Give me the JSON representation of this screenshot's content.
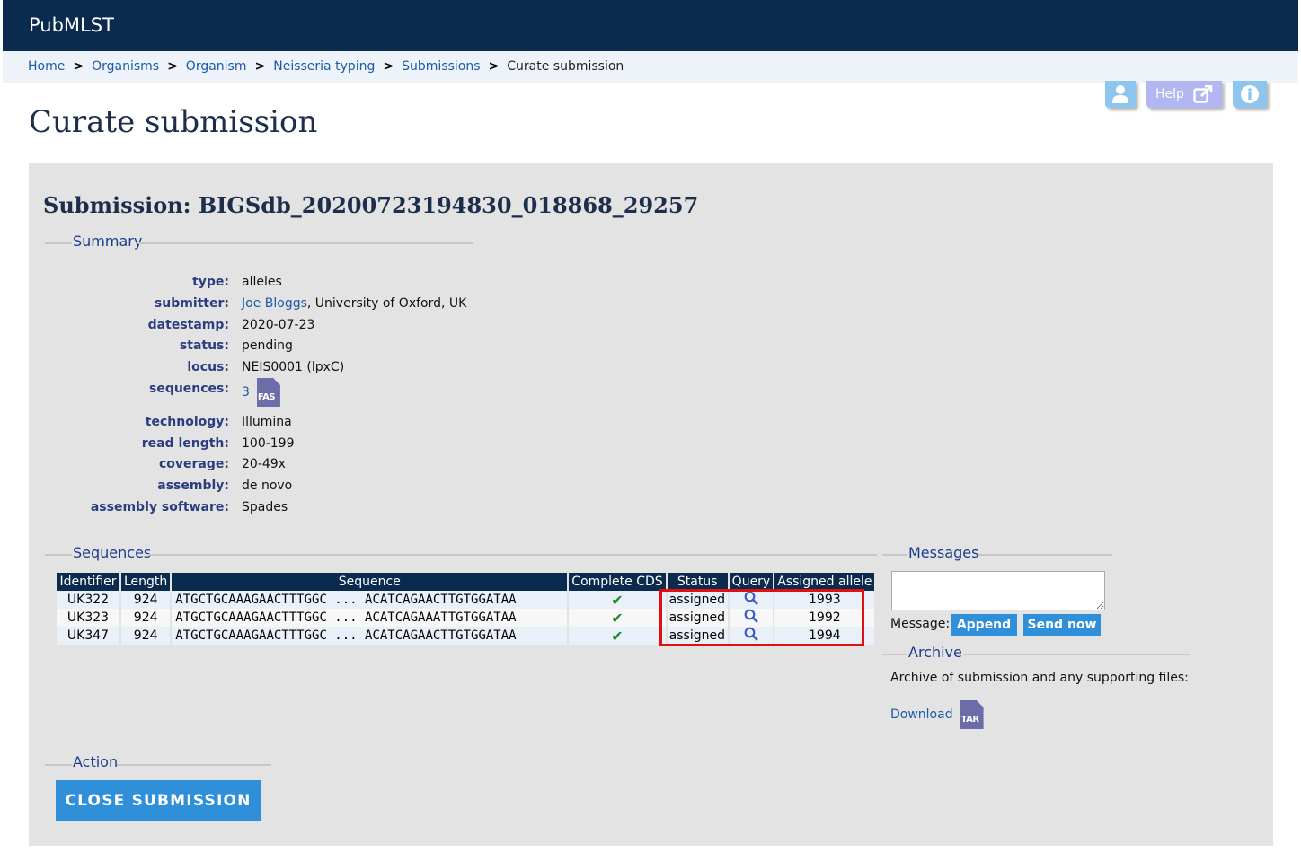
{
  "app": {
    "brand": "PubMLST"
  },
  "breadcrumb": {
    "links": [
      "Home",
      "Organisms",
      "Organism",
      "Neisseria typing",
      "Submissions"
    ],
    "separator": ">",
    "current": "Curate submission"
  },
  "toolbar": {
    "help_label": "Help"
  },
  "page": {
    "title": "Curate submission"
  },
  "submission": {
    "title": "Submission: BIGSdb_20200723194830_018868_29257",
    "summary_legend": "Summary",
    "fields": {
      "type": {
        "label": "type:",
        "value": "alleles"
      },
      "submitter": {
        "label": "submitter:",
        "name": "Joe Bloggs",
        "affiliation": ", University of Oxford, UK"
      },
      "datestamp": {
        "label": "datestamp:",
        "value": "2020-07-23"
      },
      "status": {
        "label": "status:",
        "value": "pending"
      },
      "locus": {
        "label": "locus:",
        "value": "NEIS0001 (lpxC)"
      },
      "sequences": {
        "label": "sequences:",
        "value": "3",
        "file_badge": "FAS"
      },
      "technology": {
        "label": "technology:",
        "value": "Illumina"
      },
      "read_length": {
        "label": "read length:",
        "value": "100-199"
      },
      "coverage": {
        "label": "coverage:",
        "value": "20-49x"
      },
      "assembly": {
        "label": "assembly:",
        "value": "de novo"
      },
      "assembly_software": {
        "label": "assembly software:",
        "value": "Spades"
      }
    }
  },
  "sequences_section": {
    "legend": "Sequences",
    "columns": [
      "Identifier",
      "Length",
      "Sequence",
      "Complete CDS",
      "Status",
      "Query",
      "Assigned allele"
    ],
    "rows": [
      {
        "id": "UK322",
        "length": "924",
        "sequence": "ATGCTGCAAAGAACTTTGGC ... ACATCAGAACTTGTGGATAA",
        "status": "assigned",
        "allele": "1993"
      },
      {
        "id": "UK323",
        "length": "924",
        "sequence": "ATGCTGCAAAGAACTTTGGC ... ACATCAGAAATTGTGGATAA",
        "status": "assigned",
        "allele": "1992"
      },
      {
        "id": "UK347",
        "length": "924",
        "sequence": "ATGCTGCAAAGAACTTTGGC ... ACATCAGAACTTGTGGATAA",
        "status": "assigned",
        "allele": "1994"
      }
    ]
  },
  "messages": {
    "legend": "Messages",
    "message_label": "Message:",
    "append_label": "Append",
    "send_label": "Send now"
  },
  "archive": {
    "legend": "Archive",
    "text": "Archive of submission and any supporting files:",
    "download_label": "Download",
    "file_badge": "TAR"
  },
  "action": {
    "legend": "Action",
    "close_label": "CLOSE SUBMISSION"
  },
  "colors": {
    "header_bg": "#0a2a4e",
    "accent_button": "#2f8fd8",
    "highlight_border": "#e01010",
    "check": "#1d8a2c"
  }
}
